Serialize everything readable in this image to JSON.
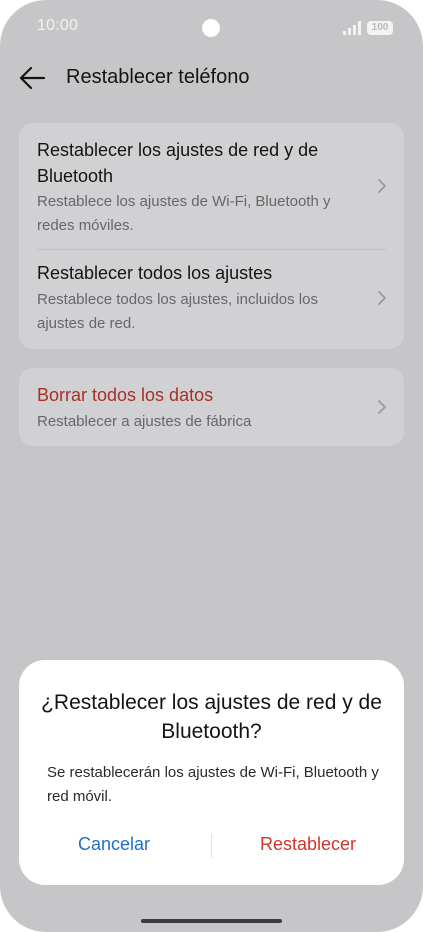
{
  "status_bar": {
    "time": "10:00",
    "battery": "100",
    "signal_icon": "signal-bars-icon",
    "battery_icon": "battery-icon"
  },
  "app_bar": {
    "back_icon": "arrow-left-icon",
    "title": "Restablecer teléfono"
  },
  "options": [
    {
      "title": "Restablecer los ajustes de red y de Bluetooth",
      "subtitle": "Restablece los ajustes de Wi-Fi, Bluetooth y redes móviles."
    },
    {
      "title": "Restablecer todos los ajustes",
      "subtitle": "Restablece todos los ajustes, incluidos los ajustes de red."
    },
    {
      "title": "Borrar todos los datos",
      "subtitle": "Restablecer a ajustes de fábrica"
    }
  ],
  "dialog": {
    "title": "¿Restablecer los ajustes de red y de Bluetooth?",
    "body": "Se restablecerán los ajustes de Wi-Fi, Bluetooth y red móvil.",
    "cancel_label": "Cancelar",
    "confirm_label": "Restablecer"
  },
  "colors": {
    "danger": "#a83024",
    "cancel_button": "#1f6fcb",
    "confirm_button": "#d0342c"
  }
}
